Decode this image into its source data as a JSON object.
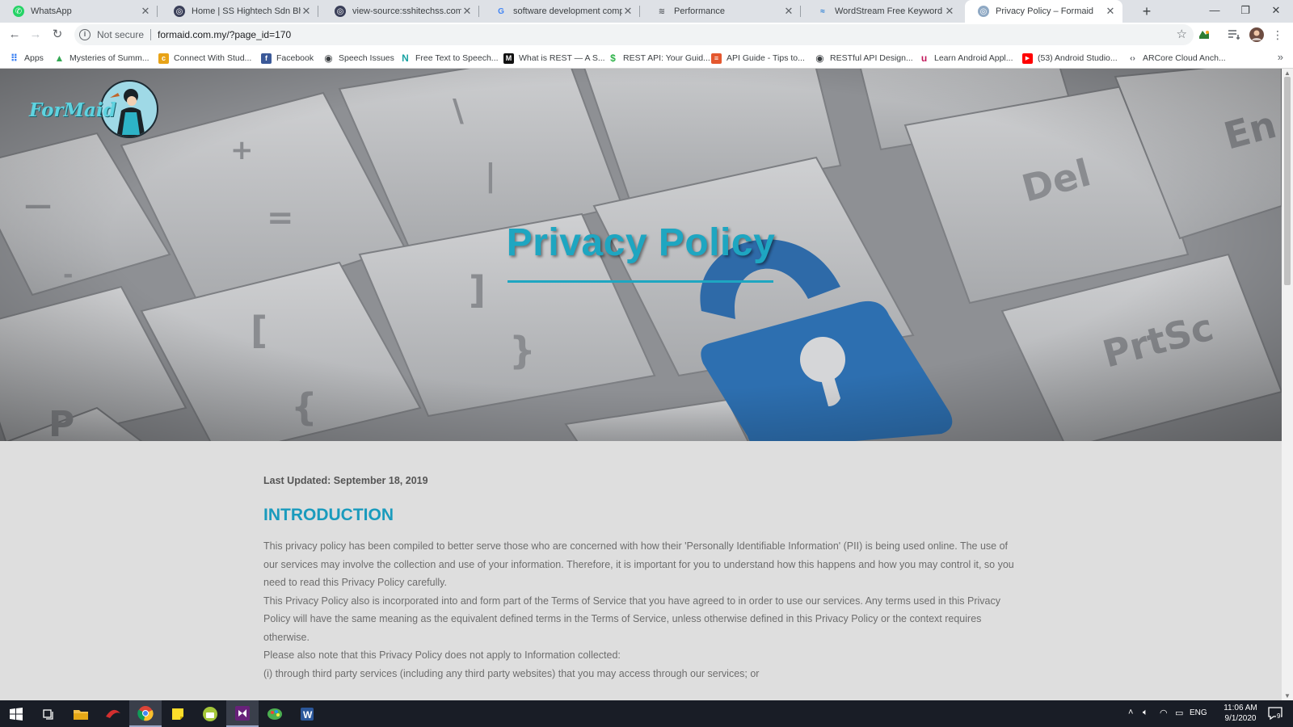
{
  "browser": {
    "tabs": [
      {
        "title": "WhatsApp",
        "icon": "whatsapp-icon",
        "color": "#25d366"
      },
      {
        "title": "Home | SS Hightech Sdn Bhd",
        "icon": "globe-icon",
        "color": "#3a3f59"
      },
      {
        "title": "view-source:sshitechss.com/inde",
        "icon": "globe-icon",
        "color": "#3a3f59"
      },
      {
        "title": "software development company",
        "icon": "google-icon",
        "color": "#4285f4"
      },
      {
        "title": "Performance",
        "icon": "performance-icon",
        "color": "#5f6368"
      },
      {
        "title": "WordStream Free Keyword Tool",
        "icon": "wordstream-icon",
        "color": "#2a7fd4"
      },
      {
        "title": "Privacy Policy – Formaid",
        "icon": "globe-icon",
        "color": "#5f6368",
        "active": true
      }
    ],
    "address": {
      "security_label": "Not secure",
      "url": "formaid.com.my/?page_id=170"
    },
    "bookmarks": [
      {
        "label": "Apps",
        "icon": "apps-grid-icon",
        "color": "#4285f4"
      },
      {
        "label": "Mysteries of Summ...",
        "icon": "google-drive-icon",
        "color": "#34a853"
      },
      {
        "label": "Connect With Stud...",
        "icon": "chegg-icon",
        "color": "#e8a317"
      },
      {
        "label": "Facebook",
        "icon": "facebook-icon",
        "color": "#3b5998"
      },
      {
        "label": "Speech Issues",
        "icon": "globe-icon",
        "color": "#3c4043"
      },
      {
        "label": "Free Text to Speech...",
        "icon": "naturalreader-icon",
        "color": "#1aa3a3"
      },
      {
        "label": "What is REST — A S...",
        "icon": "medium-icon",
        "color": "#111111"
      },
      {
        "label": "REST API: Your Guid...",
        "icon": "rest-icon",
        "color": "#2fb34a"
      },
      {
        "label": "API Guide - Tips to...",
        "icon": "api-guide-icon",
        "color": "#e4572e"
      },
      {
        "label": "RESTful API Design...",
        "icon": "globe-icon",
        "color": "#3c4043"
      },
      {
        "label": "Learn Android Appl...",
        "icon": "udemy-icon",
        "color": "#c2185b"
      },
      {
        "label": "(53) Android Studio...",
        "icon": "youtube-icon",
        "color": "#ff0000"
      },
      {
        "label": "ARCore Cloud Anch...",
        "icon": "code-icon",
        "color": "#5f6368"
      }
    ]
  },
  "page": {
    "logo_text": "ForMaid",
    "hero_title": "Privacy Policy",
    "last_updated": "Last Updated: September 18, 2019",
    "intro_heading": "INTRODUCTION",
    "paragraphs": [
      "This privacy policy has been compiled to better serve those who are concerned with how their 'Personally Identifiable Information' (PII) is being used online. The use of our services may involve the collection and use of your information. Therefore, it is important for you to understand how this happens and how you may control it, so you need to read this Privacy Policy carefully.",
      "This Privacy Policy also is incorporated into and form part of the Terms of Service that you have agreed to in order to use our services. Any terms used in this Privacy Policy will have the same meaning as the equivalent defined terms in the Terms of Service, unless otherwise defined in this Privacy Policy or the context requires otherwise.",
      "Please also note that this Privacy Policy does not apply to Information collected:",
      "(i) through third party services (including any third party websites) that you may access through our services; or"
    ],
    "accent_color": "#1ea6c1"
  },
  "taskbar": {
    "apps": [
      "windows-start-icon",
      "task-view-icon",
      "file-explorer-icon",
      "app-red-icon",
      "chrome-icon",
      "sticky-notes-icon",
      "android-icon",
      "visual-studio-icon",
      "paint-icon",
      "word-icon"
    ],
    "language": "ENG",
    "time": "11:06 AM",
    "date": "9/1/2020",
    "notification_count": "9"
  }
}
